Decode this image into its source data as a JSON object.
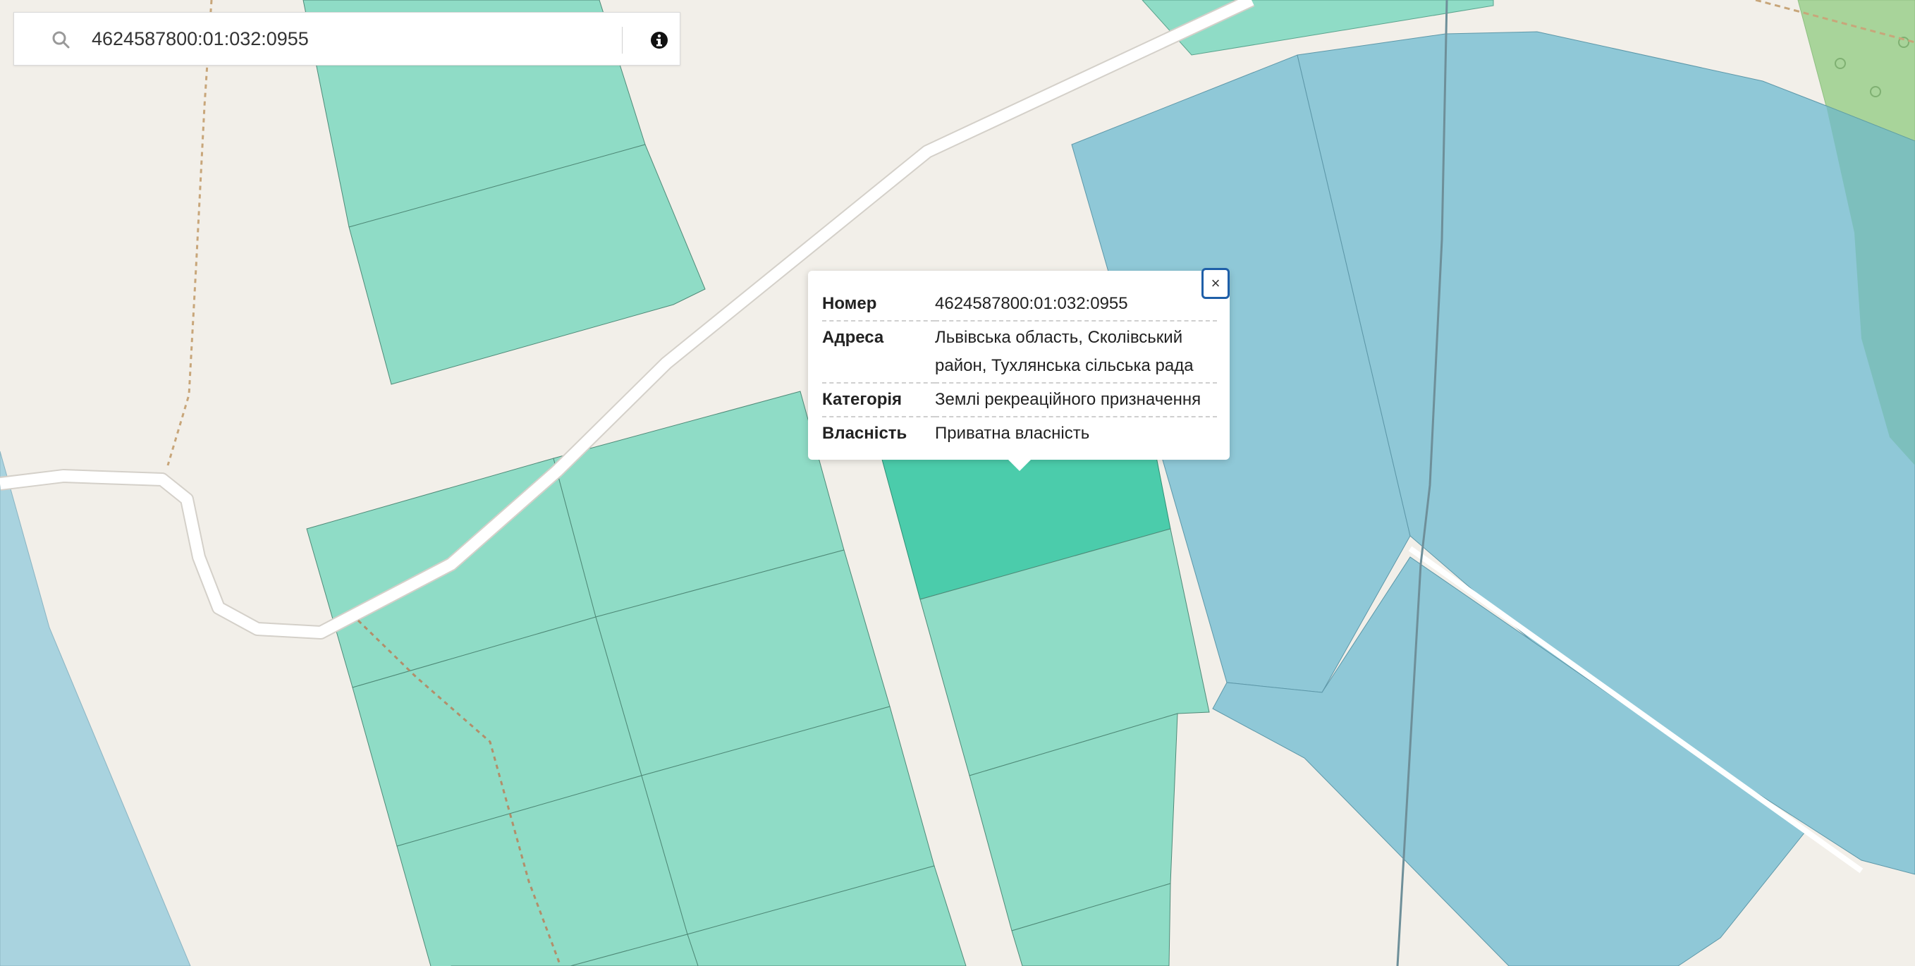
{
  "search": {
    "value": "4624587800:01:032:0955",
    "placeholder": ""
  },
  "icons": {
    "search": "search-icon",
    "info": "info-icon",
    "close": "close-icon"
  },
  "popup": {
    "close_label": "×",
    "rows": [
      {
        "label": "Номер",
        "value": "4624587800:01:032:0955"
      },
      {
        "label": "Адреса",
        "value": "Львівська область, Сколівський район, Тухлянська сільська рада"
      },
      {
        "label": "Категорія",
        "value": "Землі рекреаційного призначення"
      },
      {
        "label": "Власність",
        "value": "Приватна власність"
      }
    ]
  },
  "colors": {
    "background": "#f2efe9",
    "parcel": "#8fdcc6",
    "parcel_selected": "#4bccab",
    "forest_parcel": "#8fc8d7",
    "green_area": "#a8d49a",
    "road": "#ffffff",
    "accent": "#1f5fa8"
  }
}
